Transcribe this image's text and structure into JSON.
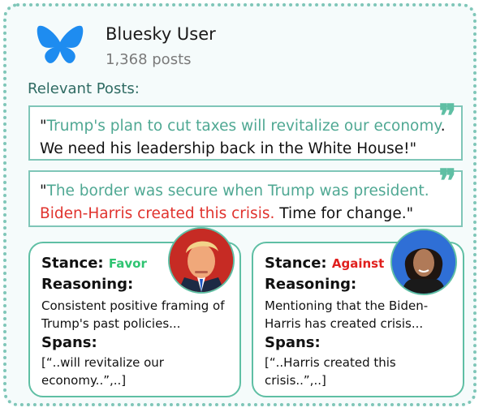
{
  "profile": {
    "name": "Bluesky User",
    "posts": "1,368 posts"
  },
  "section_title": "Relevant Posts:",
  "posts": [
    {
      "part1": "\"",
      "highlight": "Trump's plan to cut taxes will revitalize our economy",
      "part2": ". We need his leadership back in the White House!\""
    },
    {
      "part1": "\"",
      "highlight": "The border was secure when Trump was president.",
      "red": "Biden-Harris created this crisis.",
      "part2": " Time for change.\""
    }
  ],
  "cards": [
    {
      "stance_label": "Stance:",
      "stance": "Favor",
      "reasoning_label": "Reasoning:",
      "reasoning": "Consistent positive framing of Trump's past policies...",
      "spans_label": "Spans:",
      "spans": "[“..will revitalize our economy..”,..]"
    },
    {
      "stance_label": "Stance:",
      "stance": "Against",
      "reasoning_label": "Reasoning:",
      "reasoning": "Mentioning that the Biden-Harris has created crisis...",
      "spans_label": "Spans:",
      "spans": "[“..Harris created this crisis..”,..]"
    }
  ],
  "colors": {
    "accent": "#5fbfa4",
    "favor": "#2fc472",
    "against": "#e0201e",
    "logo": "#1e8cf0"
  },
  "icons": {
    "logo": "butterfly-icon",
    "quote": "quote-icon"
  }
}
